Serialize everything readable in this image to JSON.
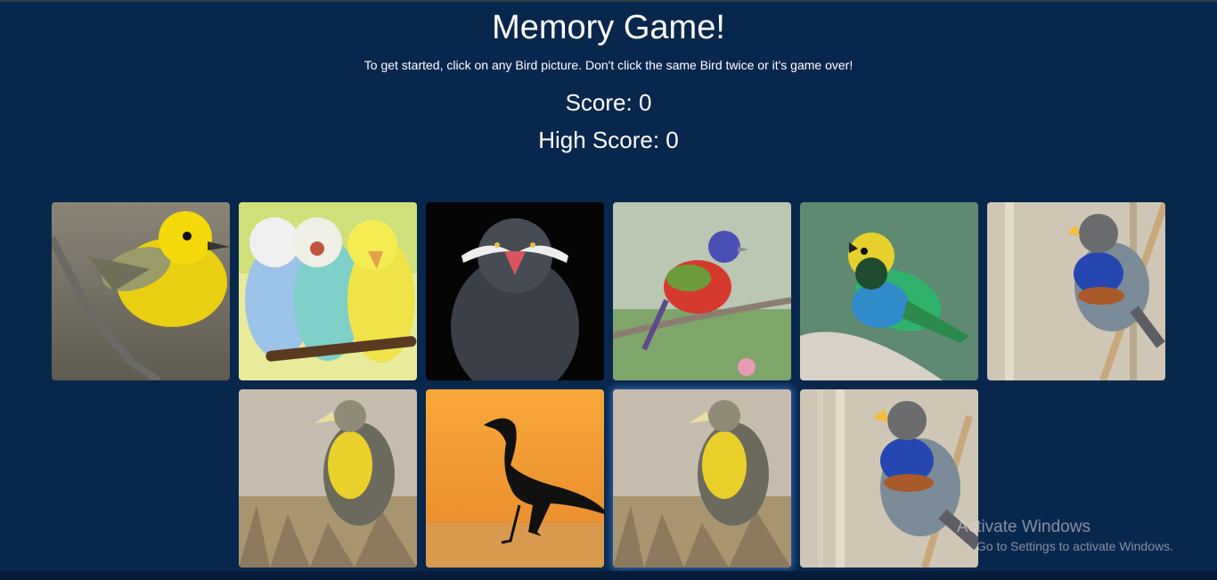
{
  "game": {
    "title": "Memory Game!",
    "instructions": "To get started, click on any Bird picture. Don't click the same Bird twice or it's game over!",
    "score_label": "Score: 0",
    "high_score_label": "High Score: 0",
    "score": 0,
    "high_score": 0
  },
  "cards": [
    {
      "bird": "yellow warbler"
    },
    {
      "bird": "budgerigars"
    },
    {
      "bird": "inca tern"
    },
    {
      "bird": "painted bunting"
    },
    {
      "bird": "multicolored tanager"
    },
    {
      "bird": "bluethroat"
    },
    {
      "bird": "western meadowlark"
    },
    {
      "bird": "heron silhouette"
    },
    {
      "bird": "western meadowlark"
    },
    {
      "bird": "bluethroat"
    }
  ],
  "watermark": {
    "title": "Activate Windows",
    "subtitle": "Go to Settings to activate Windows."
  },
  "colors": {
    "background": "#08274d",
    "text": "#ffffff"
  }
}
